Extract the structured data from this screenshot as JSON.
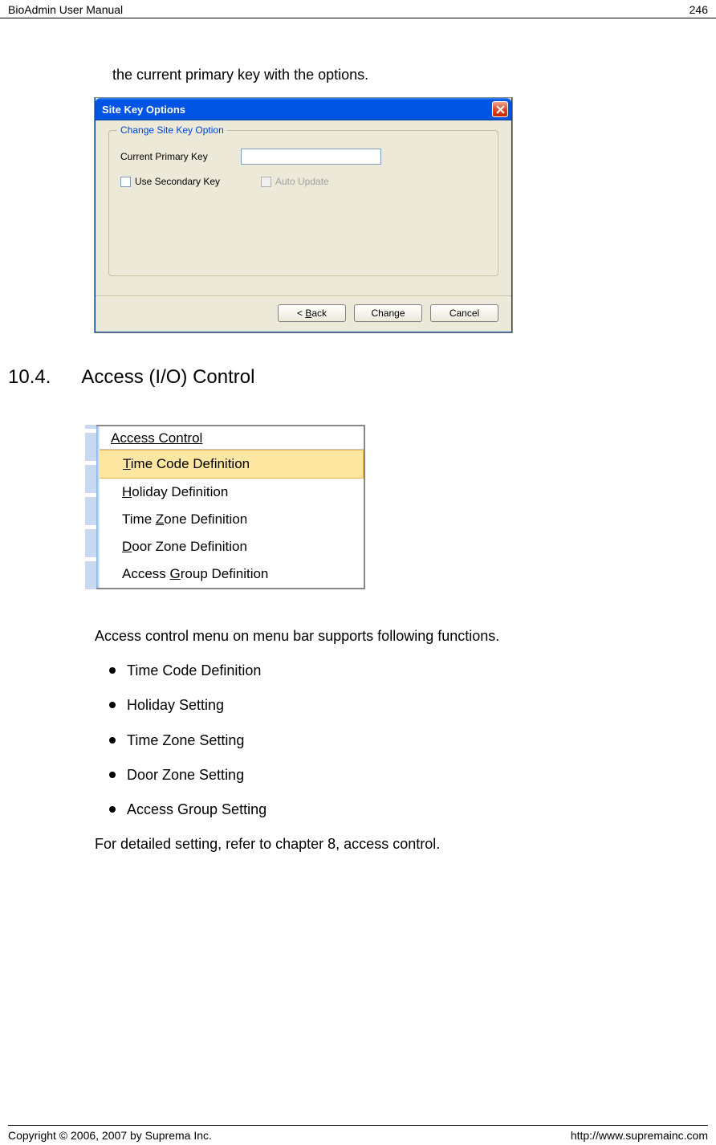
{
  "header": {
    "left": "BioAdmin User Manual",
    "right": "246"
  },
  "footer": {
    "left": "Copyright © 2006, 2007 by Suprema Inc.",
    "right": "http://www.supremainc.com"
  },
  "leadText": "the current primary key with the options.",
  "dialog": {
    "title": "Site Key Options",
    "groupLegend": "Change Site Key Option",
    "primaryKeyLabel": "Current Primary Key",
    "primaryKeyValue": "",
    "useSecondaryLabel": "Use Secondary Key",
    "autoUpdateLabel": "Auto Update",
    "backPrefix": "< ",
    "backLetter": "B",
    "backRest": "ack",
    "changeLabel": "Change",
    "cancelLabel": "Cancel"
  },
  "section": {
    "number": "10.4.",
    "title": "Access (I/O) Control"
  },
  "menu": {
    "titlePre": "A",
    "titleRest": "ccess Control",
    "items": [
      {
        "pre": "",
        "u": "T",
        "post": "ime Code Definition",
        "hl": true
      },
      {
        "pre": "",
        "u": "H",
        "post": "oliday Definition",
        "hl": false
      },
      {
        "pre": "Time ",
        "u": "Z",
        "post": "one Definition",
        "hl": false
      },
      {
        "pre": "",
        "u": "D",
        "post": "oor Zone Definition",
        "hl": false
      },
      {
        "pre": "Access ",
        "u": "G",
        "post": "roup Definition",
        "hl": false
      }
    ]
  },
  "body": {
    "intro": "Access control menu on menu bar supports following functions.",
    "bullets": [
      "Time Code Definition",
      "Holiday Setting",
      "Time Zone Setting",
      "Door Zone Setting",
      "Access Group Setting"
    ],
    "outro": "For detailed setting, refer to chapter 8, access control."
  }
}
